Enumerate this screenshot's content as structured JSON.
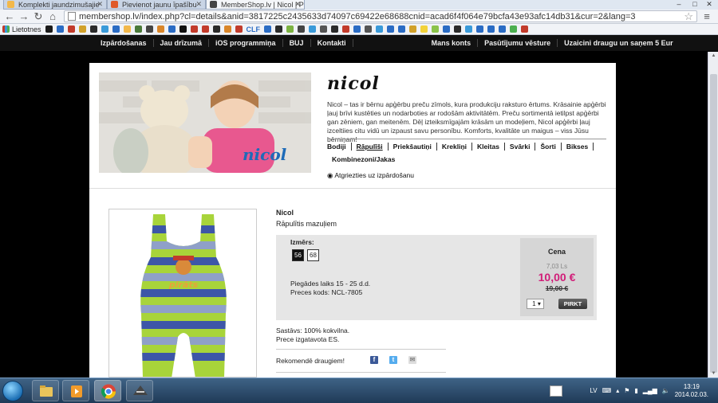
{
  "browser": {
    "tabs": [
      {
        "title": "Komplekti jaundzimušajie",
        "color": "#f2b84b",
        "active": false
      },
      {
        "title": "Pievienot jaunu īpašību",
        "color": "#e05a2a",
        "active": false
      },
      {
        "title": "MemberShop.lv | Nicol | P",
        "color": "#444444",
        "active": true
      }
    ],
    "url": "membershop.lv/index.php?cl=details&anid=3817225c2435633d74097c69422e68688cnid=acad6f4f064e79bcfa43e93afc14db31&cur=2&lang=3",
    "bookmarks_label": "Lietotnes",
    "bookmark_icons": [
      "#1a1a1a",
      "#2b6cc4",
      "#c23b2b",
      "#d1a12a",
      "#2b2b2b",
      "#3a9ad9",
      "#2b6cc4",
      "#f2b84b",
      "#4a7a3a",
      "#444444",
      "#d9862a",
      "#2b6cc4",
      "#111111",
      "#c23b2b",
      "#c23b2b",
      "#2b2b2b",
      "#d9862a",
      "#c23b2b",
      "#2b6cc4",
      "#2b2b2b",
      "#7cb342",
      "#444444",
      "#3a9ad9",
      "#555555",
      "#2b2b2b",
      "#c23b2b",
      "#2b6cc4",
      "#555555",
      "#3a9ad9",
      "#2b6cc4",
      "#2b6cc4",
      "#d1a12a",
      "#f2d23a",
      "#8bc34a",
      "#2b6cc4",
      "#2b2b2b",
      "#3a9ad9",
      "#2b6cc4",
      "#2b6cc4",
      "#2b6cc4",
      "#4caf50",
      "#c23b2b"
    ],
    "bookmark_texts": [
      "CLF"
    ]
  },
  "site_nav": {
    "left": [
      "Izpārdošanas",
      "Jau drīzumā",
      "iOS programmiņa",
      "BUJ",
      "Kontakti"
    ],
    "right": [
      "Mans konts",
      "Pasūtījumu vēsture",
      "Uzaicini draugu un saņem 5 Eur"
    ]
  },
  "brand": {
    "logo": "nicol",
    "hero_logo": "nicol",
    "description": "Nicol – tas ir bērnu apģērbu preču zīmols, kura produkciju raksturo ērtums. Krāsainie apģērbi ļauj brīvi kustēties un nodarboties ar rodošām aktivitātēm. Preču sortimentā ietilpst apģērbi gan zēniem, gan meitenēm. Dēļ izteiksmīgajām krāsām un modeļiem, Nicol apģērbi ļauj izceltiies citu vidū un izpaust savu personību. Komforts, kvalitāte un maigus – viss Jūsu bērniņam!",
    "categories": [
      "Bodiji",
      "Rāpulīši",
      "Priekšautiņi",
      "Krekliņi",
      "Kleitas",
      "Svārki",
      "Šorti",
      "Bikses",
      "Kombinezoni/Jakas"
    ],
    "current_category": "Rāpulīši",
    "back_link": "Atgriezties uz izpārdošanu"
  },
  "product": {
    "brand": "Nicol",
    "name": "Rāpulītis mazuļiem",
    "image_text": "pirāts",
    "size_label": "Izmērs:",
    "sizes": [
      "56",
      "68"
    ],
    "selected_size": "56",
    "delivery": "Piegādes laiks 15 - 25 d.d.",
    "code": "Preces kods: NCL-7805",
    "price_title": "Cena",
    "price_ls": "7,03 Ls",
    "price_eur": "10,00 €",
    "price_old": "19,00 €",
    "qty": "1",
    "buy_label": "PIRKT",
    "composition": "Sastāvs: 100% kokvilna.",
    "made_in": "Prece izgatavota ES.",
    "recommend": "Rekomendē draugiem!",
    "accent": "#d11d78"
  },
  "taskbar": {
    "lang": "LV",
    "time": "13:19",
    "date": "2014.02.03."
  }
}
